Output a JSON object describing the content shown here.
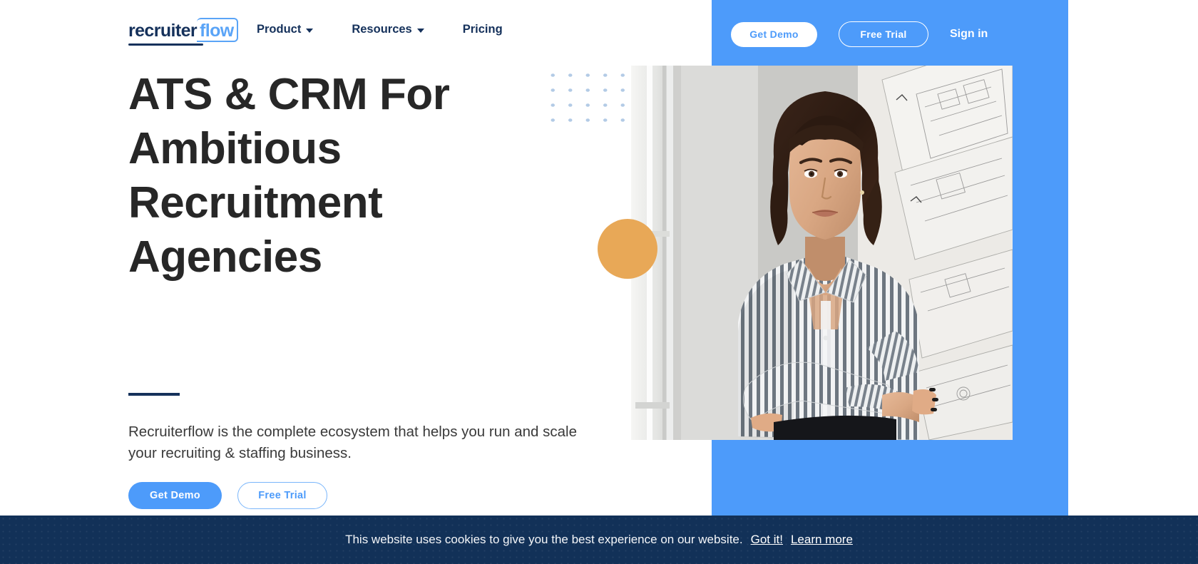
{
  "header": {
    "logo": {
      "part1": "recruiter",
      "part2": "flow"
    },
    "nav": [
      {
        "label": "Product",
        "has_dropdown": true
      },
      {
        "label": "Resources",
        "has_dropdown": true
      },
      {
        "label": "Pricing",
        "has_dropdown": false
      }
    ],
    "actions": {
      "get_demo": "Get Demo",
      "free_trial": "Free Trial",
      "sign_in": "Sign in"
    }
  },
  "hero": {
    "headline": "ATS & CRM For Ambitious Recruitment Agencies",
    "subtext": "Recruiterflow is the complete ecosystem that helps you run and scale your recruiting & staffing business.",
    "get_demo": "Get Demo",
    "free_trial": "Free Trial",
    "image_alt": "woman-with-crossed-arms-photo"
  },
  "cookie_banner": {
    "message": "This website uses cookies to give you the best experience on our website.",
    "accept": "Got it!",
    "learn_more": "Learn more"
  },
  "colors": {
    "brand_blue": "#4d9bfa",
    "logo_navy": "#15315b",
    "accent_orange": "#e8a857",
    "dot_blue": "#b3cbe6",
    "cookie_navy": "#123158",
    "headline_dark": "#272727"
  }
}
